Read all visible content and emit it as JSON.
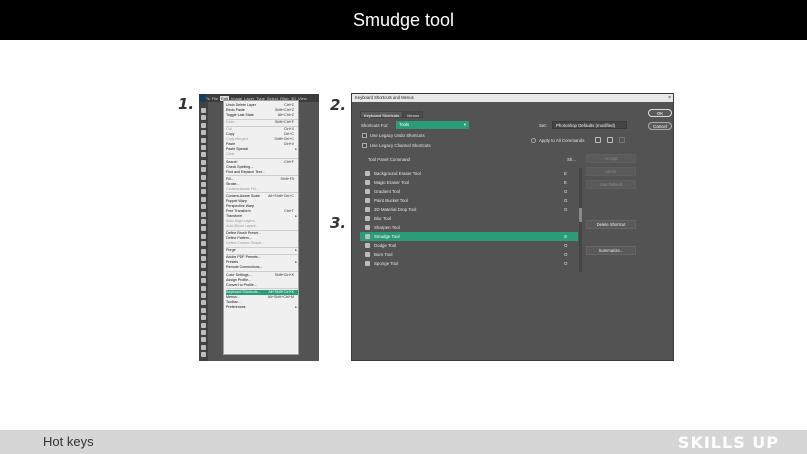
{
  "slide": {
    "title": "Smudge tool",
    "footer_label": "Hot keys",
    "brand": "SKILLS UP",
    "steps": [
      "1.",
      "2.",
      "3."
    ]
  },
  "photoshop": {
    "menubar": [
      "Ps",
      "File",
      "Edit",
      "Image",
      "Layer",
      "Type",
      "Select",
      "Filter",
      "3D",
      "View"
    ],
    "active_menu": "Edit",
    "edit_menu": [
      {
        "label": "Undo Delete Layer",
        "shortcut": "Ctrl+Z"
      },
      {
        "label": "Redo Paste",
        "shortcut": "Shift+Ctrl+Z"
      },
      {
        "label": "Toggle Last State",
        "shortcut": "Alt+Ctrl+Z"
      },
      {
        "sep": true
      },
      {
        "label": "Fade...",
        "shortcut": "Shift+Ctrl+F",
        "disabled": true
      },
      {
        "sep": true
      },
      {
        "label": "Cut",
        "shortcut": "Ctrl+X",
        "disabled": true
      },
      {
        "label": "Copy",
        "shortcut": "Ctrl+C"
      },
      {
        "label": "Copy Merged",
        "shortcut": "Shift+Ctrl+C",
        "disabled": true
      },
      {
        "label": "Paste",
        "shortcut": "Ctrl+V"
      },
      {
        "label": "Paste Special",
        "submenu": true
      },
      {
        "label": "Clear",
        "disabled": true
      },
      {
        "sep": true
      },
      {
        "label": "Search",
        "shortcut": "Ctrl+F"
      },
      {
        "label": "Check Spelling..."
      },
      {
        "label": "Find and Replace Text..."
      },
      {
        "sep": true
      },
      {
        "label": "Fill...",
        "shortcut": "Shift+F5"
      },
      {
        "label": "Stroke..."
      },
      {
        "label": "Content-Aware Fill...",
        "disabled": true
      },
      {
        "sep": true
      },
      {
        "label": "Content-Aware Scale",
        "shortcut": "Alt+Shift+Ctrl+C"
      },
      {
        "label": "Puppet Warp"
      },
      {
        "label": "Perspective Warp"
      },
      {
        "label": "Free Transform",
        "shortcut": "Ctrl+T"
      },
      {
        "label": "Transform",
        "submenu": true
      },
      {
        "label": "Auto-Align Layers...",
        "disabled": true
      },
      {
        "label": "Auto-Blend Layers...",
        "disabled": true
      },
      {
        "sep": true
      },
      {
        "label": "Define Brush Preset..."
      },
      {
        "label": "Define Pattern..."
      },
      {
        "label": "Define Custom Shape...",
        "disabled": true
      },
      {
        "sep": true
      },
      {
        "label": "Purge",
        "submenu": true
      },
      {
        "sep": true
      },
      {
        "label": "Adobe PDF Presets..."
      },
      {
        "label": "Presets",
        "submenu": true
      },
      {
        "label": "Remote Connections..."
      },
      {
        "sep": true
      },
      {
        "label": "Color Settings...",
        "shortcut": "Shift+Ctrl+K"
      },
      {
        "label": "Assign Profile..."
      },
      {
        "label": "Convert to Profile..."
      },
      {
        "sep": true
      },
      {
        "label": "Keyboard Shortcuts...",
        "shortcut": "Alt+Shift+Ctrl+K",
        "highlight": true
      },
      {
        "label": "Menus...",
        "shortcut": "Alt+Shift+Ctrl+M"
      },
      {
        "label": "Toolbar..."
      },
      {
        "label": "Preferences",
        "submenu": true
      }
    ]
  },
  "dialog": {
    "title": "Keyboard Shortcuts and Menus",
    "close": "×",
    "tabs": [
      "Keyboard Shortcuts",
      "Menus"
    ],
    "shortcuts_for_label": "Shortcuts For:",
    "shortcuts_for_value": "Tools",
    "set_label": "Set:",
    "set_value": "Photoshop Defaults (modified)",
    "legacy_undo": "Use Legacy Undo Shortcuts",
    "legacy_channel": "Use Legacy Channel Shortcuts",
    "apply_all": "Apply to All Commands",
    "ok": "OK",
    "cancel": "Cancel",
    "col_command": "Tool Panel Command",
    "col_shortcut": "Sh...",
    "buttons": {
      "accept": "Accept",
      "undo": "Undo",
      "use_default": "Use Default",
      "delete": "Delete Shortcut",
      "summarize": "Summarize..."
    },
    "rows": [
      {
        "name": "Background Eraser Tool",
        "key": "E"
      },
      {
        "name": "Magic Eraser Tool",
        "key": "E"
      },
      {
        "name": "Gradient Tool",
        "key": "G"
      },
      {
        "name": "Paint Bucket Tool",
        "key": "G"
      },
      {
        "name": "3D Material Drop Tool",
        "key": "G"
      },
      {
        "name": "Blur Tool",
        "key": ""
      },
      {
        "name": "Sharpen Tool",
        "key": ""
      },
      {
        "name": "Smudge Tool",
        "key": "S",
        "highlight": true
      },
      {
        "name": "Dodge Tool",
        "key": "O"
      },
      {
        "name": "Burn Tool",
        "key": "O"
      },
      {
        "name": "Sponge Tool",
        "key": "O"
      }
    ]
  },
  "colors": {
    "accent": "#2b9c7b",
    "ps_bg": "#535353",
    "top_bar": "#000000"
  }
}
